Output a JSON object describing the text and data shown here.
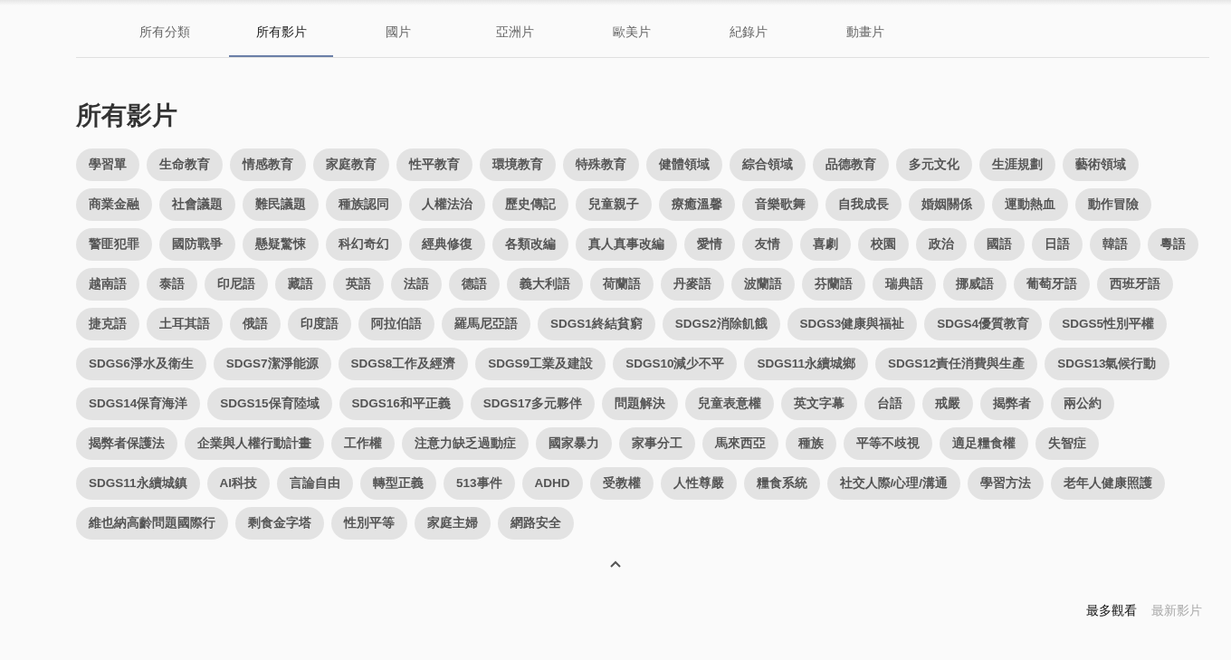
{
  "tabs": [
    {
      "label": "所有分類",
      "selected": false
    },
    {
      "label": "所有影片",
      "selected": true
    },
    {
      "label": "國片",
      "selected": false
    },
    {
      "label": "亞洲片",
      "selected": false
    },
    {
      "label": "歐美片",
      "selected": false
    },
    {
      "label": "紀錄片",
      "selected": false
    },
    {
      "label": "動畫片",
      "selected": false
    }
  ],
  "heading": "所有影片",
  "tags": [
    "學習單",
    "生命教育",
    "情感教育",
    "家庭教育",
    "性平教育",
    "環境教育",
    "特殊教育",
    "健體領域",
    "綜合領域",
    "品德教育",
    "多元文化",
    "生涯規劃",
    "藝術領域",
    "商業金融",
    "社會議題",
    "難民議題",
    "種族認同",
    "人權法治",
    "歷史傳記",
    "兒童親子",
    "療癒溫馨",
    "音樂歌舞",
    "自我成長",
    "婚姻關係",
    "運動熱血",
    "動作冒險",
    "警匪犯罪",
    "國防戰爭",
    "懸疑驚悚",
    "科幻奇幻",
    "經典修復",
    "各類改編",
    "真人真事改編",
    "愛情",
    "友情",
    "喜劇",
    "校園",
    "政治",
    "國語",
    "日語",
    "韓語",
    "粵語",
    "越南語",
    "泰語",
    "印尼語",
    "藏語",
    "英語",
    "法語",
    "德語",
    "義大利語",
    "荷蘭語",
    "丹麥語",
    "波蘭語",
    "芬蘭語",
    "瑞典語",
    "挪威語",
    "葡萄牙語",
    "西班牙語",
    "捷克語",
    "土耳其語",
    "俄語",
    "印度語",
    "阿拉伯語",
    "羅馬尼亞語",
    "SDGS1終結貧窮",
    "SDGS2消除飢餓",
    "SDGS3健康與福祉",
    "SDGS4優質教育",
    "SDGS5性別平權",
    "SDGS6淨水及衛生",
    "SDGS7潔淨能源",
    "SDGS8工作及經濟",
    "SDGS9工業及建設",
    "SDGS10減少不平",
    "SDGS11永續城鄉",
    "SDGS12責任消費與生產",
    "SDGS13氣候行動",
    "SDGS14保育海洋",
    "SDGS15保育陸域",
    "SDGS16和平正義",
    "SDGS17多元夥伴",
    "問題解決",
    "兒童表意權",
    "英文字幕",
    "台語",
    "戒嚴",
    "揭弊者",
    "兩公約",
    "揭弊者保護法",
    "企業與人權行動計畫",
    "工作權",
    "注意力缺乏過動症",
    "國家暴力",
    "家事分工",
    "馬來西亞",
    "種族",
    "平等不歧視",
    "適足糧食權",
    "失智症",
    "SDGS11永續城鎮",
    "AI科技",
    "言論自由",
    "轉型正義",
    "513事件",
    "ADHD",
    "受教權",
    "人性尊嚴",
    "糧食系統",
    "社交人際/心理/溝通",
    "學習方法",
    "老年人健康照護",
    "維也納高齡問題國際行",
    "剩食金字塔",
    "性別平等",
    "家庭主婦",
    "網路安全"
  ],
  "sort_options": [
    {
      "label": "最多觀看",
      "selected": true
    },
    {
      "label": "最新影片",
      "selected": false
    }
  ]
}
